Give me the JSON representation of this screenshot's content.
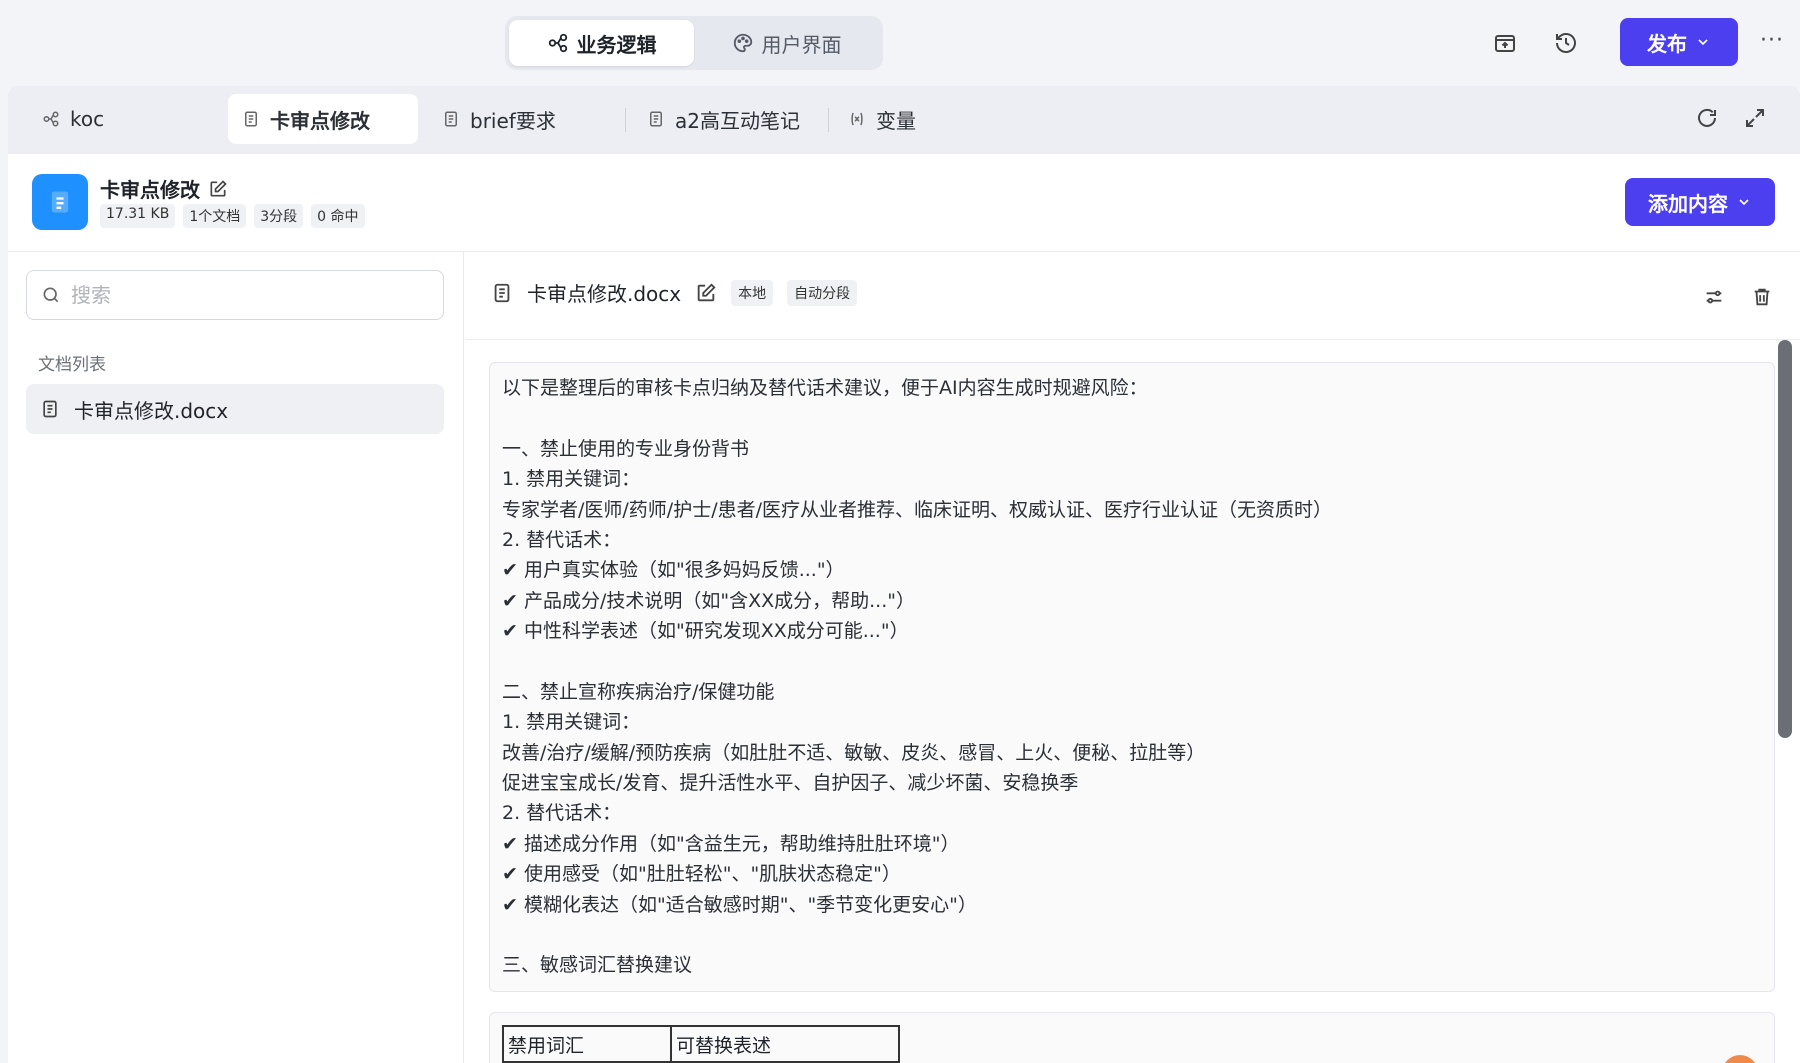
{
  "top": {
    "modes": [
      {
        "label": "业务逻辑",
        "icon": "flow-icon"
      },
      {
        "label": "用户界面",
        "icon": "palette-icon"
      }
    ],
    "publish_label": "发布",
    "more_label": "···"
  },
  "tabs": [
    {
      "label": "koc",
      "icon": "flow-icon"
    },
    {
      "label": "卡审点修改",
      "icon": "doc-icon"
    },
    {
      "label": "brief要求",
      "icon": "doc-icon"
    },
    {
      "label": "a2高互动笔记",
      "icon": "doc-icon"
    },
    {
      "label": "变量",
      "icon": "variable-icon"
    }
  ],
  "kb": {
    "title": "卡审点修改",
    "size": "17.31 KB",
    "docs": "1个文档",
    "segments": "3分段",
    "hits": "0 命中",
    "add_label": "添加内容"
  },
  "sidebar": {
    "search_placeholder": "搜索",
    "list_label": "文档列表",
    "items": [
      {
        "label": "卡审点修改.docx"
      }
    ]
  },
  "doc": {
    "filename": "卡审点修改.docx",
    "tag_local": "本地",
    "tag_auto": "自动分段"
  },
  "segment_lines": [
    "以下是整理后的审核卡点归纳及替代话术建议，便于AI内容生成时规避风险：",
    "",
    "一、禁止使用的专业身份背书",
    "1. 禁用关键词：",
    "专家学者/医师/药师/护士/患者/医疗从业者推荐、临床证明、权威认证、医疗行业认证（无资质时）",
    "2. 替代话术：",
    "✔ 用户真实体验（如\"很多妈妈反馈...\"）",
    "✔ 产品成分/技术说明（如\"含XX成分，帮助...\"）",
    "✔ 中性科学表述（如\"研究发现XX成分可能...\"）",
    "",
    "二、禁止宣称疾病治疗/保健功能",
    "1. 禁用关键词：",
    "改善/治疗/缓解/预防疾病（如肚肚不适、敏敏、皮炎、感冒、上火、便秘、拉肚等）",
    "促进宝宝成长/发育、提升活性水平、自护因子、减少坏菌、安稳换季",
    "2. 替代话术：",
    "✔ 描述成分作用（如\"含益生元，帮助维持肚肚环境\"）",
    "✔ 使用感受（如\"肚肚轻松\"、\"肌肤状态稳定\"）",
    "✔ 模糊化表达（如\"适合敏感时期\"、\"季节变化更安心\"）",
    "",
    "三、敏感词汇替换建议"
  ],
  "table": {
    "col1": "禁用词汇",
    "col2": "可替换表述"
  }
}
